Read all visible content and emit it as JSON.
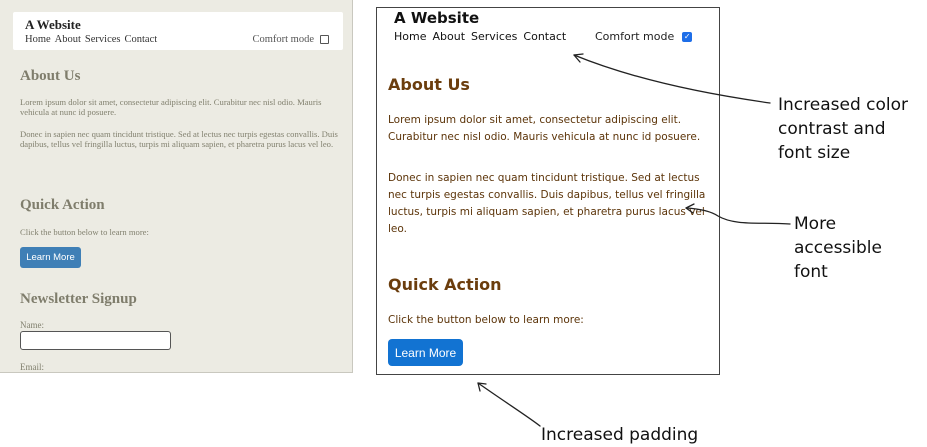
{
  "left": {
    "site_title": "A Website",
    "nav": [
      "Home",
      "About",
      "Services",
      "Contact"
    ],
    "comfort_label": "Comfort mode",
    "comfort_checked": false,
    "about_heading": "About Us",
    "about_p1": "Lorem ipsum dolor sit amet, consectetur adipiscing elit. Curabitur nec nisl odio. Mauris vehicula at nunc id posuere.",
    "about_p2": "Donec in sapien nec quam tincidunt tristique. Sed at lectus nec turpis egestas convallis. Duis dapibus, tellus vel fringilla luctus, turpis mi aliquam sapien, et pharetra purus lacus vel leo.",
    "quick_heading": "Quick Action",
    "quick_text": "Click the button below to learn more:",
    "button_label": "Learn More",
    "newsletter_heading": "Newsletter Signup",
    "name_label": "Name:",
    "email_label": "Email:"
  },
  "right": {
    "site_title": "A Website",
    "nav": [
      "Home",
      "About",
      "Services",
      "Contact"
    ],
    "comfort_label": "Comfort mode",
    "comfort_checked": true,
    "about_heading": "About Us",
    "about_p1": "Lorem ipsum dolor sit amet, consectetur adipiscing elit. Curabitur nec nisl odio. Mauris vehicula at nunc id posuere.",
    "about_p2": "Donec in sapien nec quam tincidunt tristique. Sed at lectus nec turpis egestas convallis. Duis dapibus, tellus vel fringilla luctus, turpis mi aliquam sapien, et pharetra purus lacus vel leo.",
    "quick_heading": "Quick Action",
    "quick_text": "Click the button below to learn more:",
    "button_label": "Learn More"
  },
  "annotations": {
    "contrast_line1": "Increased color",
    "contrast_line2": "contrast and",
    "contrast_line3": "font size",
    "font_line1": "More",
    "font_line2": "accessible",
    "font_line3": "font",
    "padding": "Increased padding"
  },
  "colors": {
    "left_background": "#ecebe3",
    "left_heading": "#7f7d6c",
    "right_heading": "#6b3d0d",
    "right_text": "#5c3409",
    "right_button": "#1273d2",
    "left_button": "#3f7fb6"
  }
}
